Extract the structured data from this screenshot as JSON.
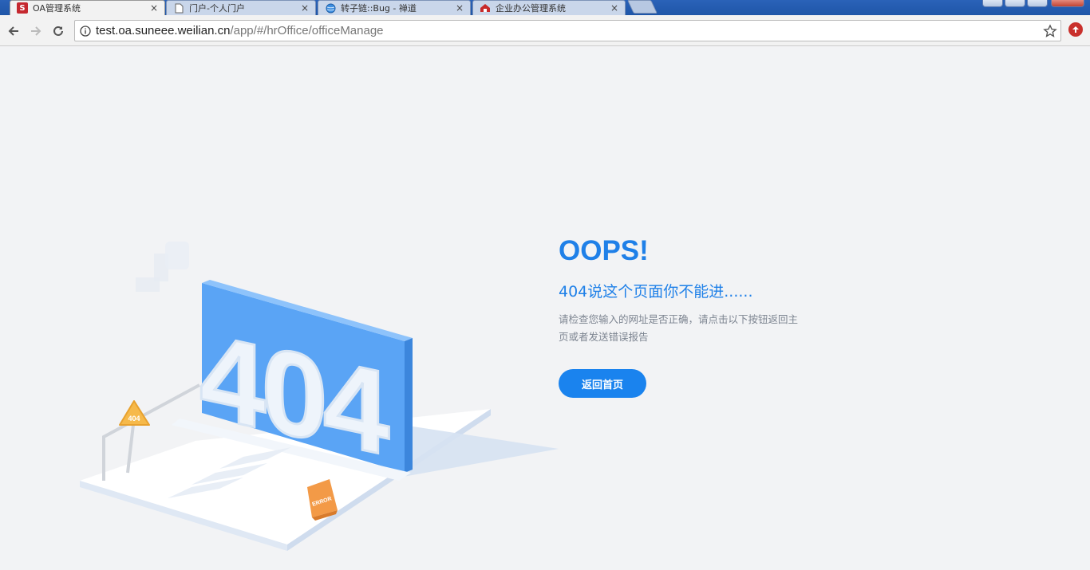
{
  "tabs": [
    {
      "label": "OA管理系统",
      "icon": "s-logo-icon",
      "active": true
    },
    {
      "label": "门户-个人门户",
      "icon": "page-icon",
      "active": false
    },
    {
      "label": "转子链::Bug - 禅道",
      "icon": "globe-icon",
      "active": false
    },
    {
      "label": "企业办公管理系统",
      "icon": "home-icon",
      "active": false
    }
  ],
  "tab_close": "×",
  "address": {
    "host": "test.oa.suneee.weilian.cn",
    "path": "/app/#/hrOffice/officeManage"
  },
  "illustration": {
    "big_number": "404",
    "sign_text": "404",
    "error_sign": "ERROR"
  },
  "error_page": {
    "title": "OOPS!",
    "subtitle": "404说这个页面你不能进......",
    "description": "请检查您输入的网址是否正确，请点击以下按钮返回主页或者发送错误报告",
    "home_button": "返回首页"
  },
  "colors": {
    "accent": "#1f80e8",
    "button": "#1a83ee",
    "background": "#f2f3f5"
  }
}
